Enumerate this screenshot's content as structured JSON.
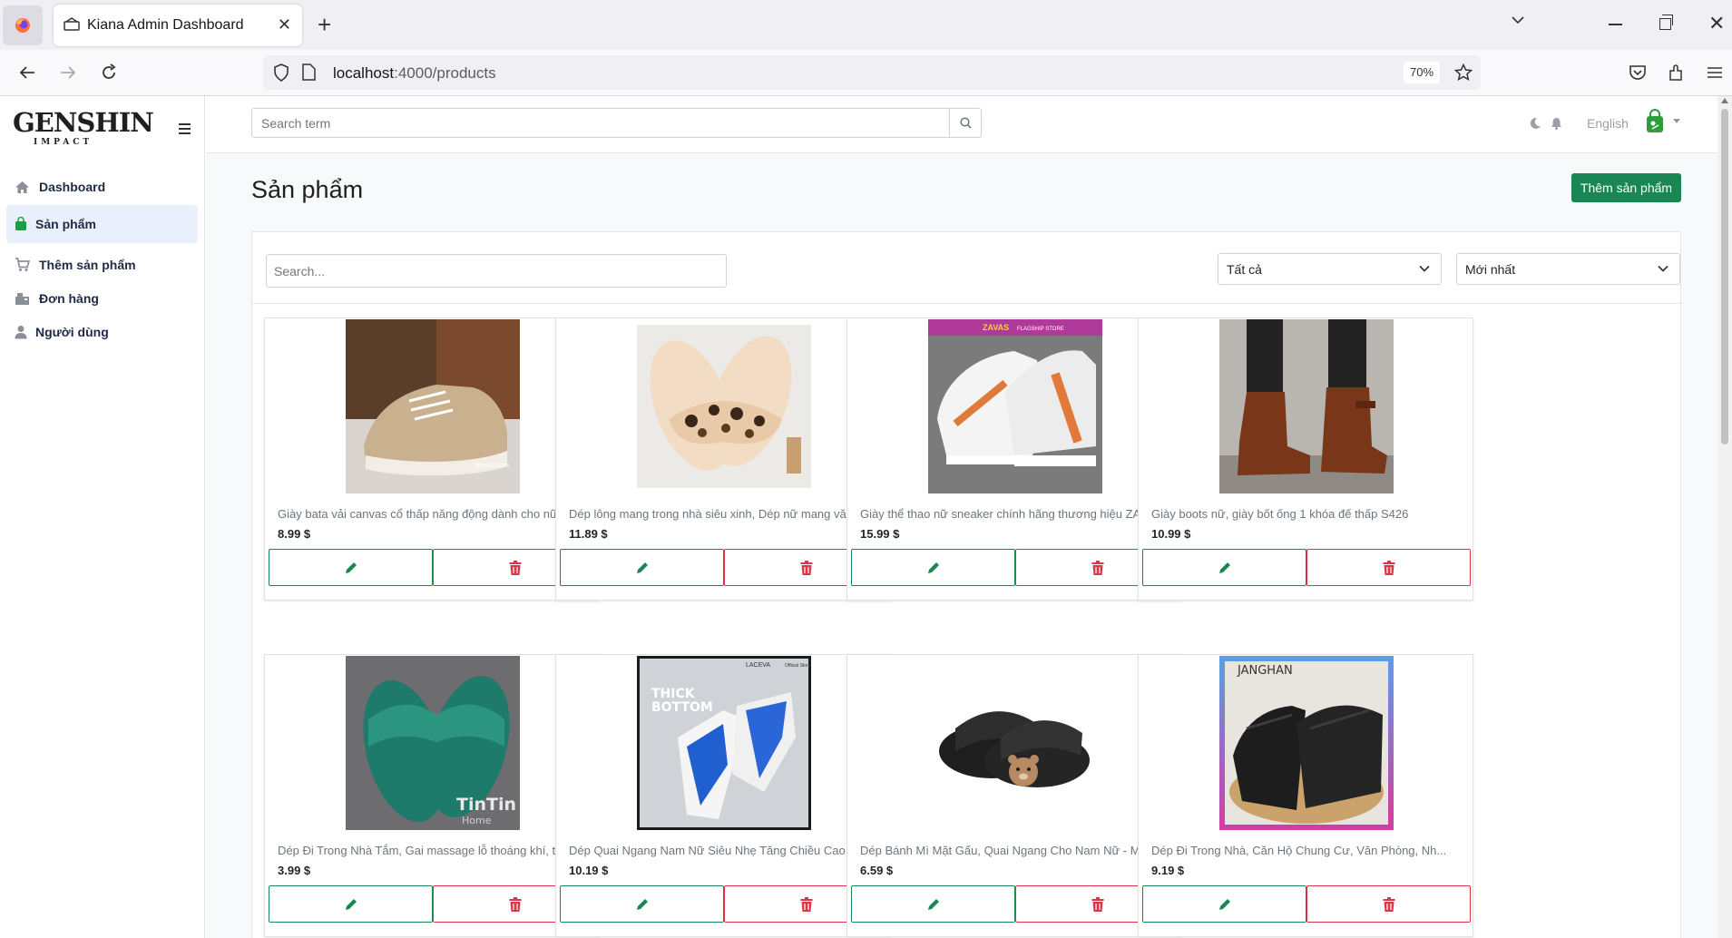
{
  "browser": {
    "tab_title": "Kiana Admin Dashboard",
    "url_host": "localhost",
    "url_rest": ":4000/products",
    "zoom": "70%"
  },
  "sidebar": {
    "logo": "GENSHIN",
    "logo_sub": "IMPACT",
    "items": [
      {
        "label": "Dashboard",
        "icon": "home-icon"
      },
      {
        "label": "Sản phẩm",
        "icon": "shopping-bag-icon"
      },
      {
        "label": "Thêm sản phẩm",
        "icon": "cart-plus-icon"
      },
      {
        "label": "Đơn hàng",
        "icon": "orders-icon"
      },
      {
        "label": "Người dùng",
        "icon": "user-icon"
      }
    ]
  },
  "topbar": {
    "search_placeholder": "Search term",
    "language": "English"
  },
  "main": {
    "title": "Sản phẩm",
    "add_button": "Thêm sản phẩm",
    "filter_placeholder": "Search...",
    "category_select": "Tất cả",
    "sort_select": "Mới nhất"
  },
  "products": [
    {
      "name": "Giày bata vải canvas cổ thấp năng động dành cho nữ",
      "price": "8.99 $",
      "image": "beige-canvas-sneaker"
    },
    {
      "name": "Dép lông mang trong nhà siêu xinh, Dép nữ mang vă...",
      "price": "11.89 $",
      "image": "leopard-fur-slipper"
    },
    {
      "name": "Giày thể thao nữ sneaker chính hãng thương hiệu ZA...",
      "price": "15.99 $",
      "image": "white-orange-sneaker"
    },
    {
      "name": "Giày boots nữ, giày bốt ống 1 khóa đế thấp S426",
      "price": "10.99 $",
      "image": "brown-ankle-boot"
    },
    {
      "name": "Dép Đi Trong Nhà Tắm, Gai massage lỗ thoáng khí, th...",
      "price": "3.99 $",
      "image": "green-massage-slipper"
    },
    {
      "name": "Dép Quai Ngang Nam Nữ Siêu Nhẹ Tăng Chiều Cao C...",
      "price": "10.19 $",
      "image": "white-blue-slide"
    },
    {
      "name": "Dép Bánh Mì Mặt Gấu, Quai Ngang Cho Nam Nữ - M...",
      "price": "6.59 $",
      "image": "black-bear-slide"
    },
    {
      "name": "Dép Đi Trong Nhà, Căn Hộ Chung Cư, Văn Phòng, Nh...",
      "price": "9.19 $",
      "image": "black-house-slide"
    }
  ],
  "image_texts": {
    "p1_watermark": "Mantis.store",
    "p3_brand": "ZAVAS",
    "p3_brand_sub": "FLAGSHIP STORE",
    "p5_brand": "TinTin",
    "p5_brand_sub": "Home",
    "p6_brand": "LACEVA",
    "p6_brand_sub": "Official Store",
    "p6_headline_1": "THICK",
    "p6_headline_2": "BOTTOM",
    "p8_brand": "JANGHAN"
  },
  "colors": {
    "primary_green": "#198754",
    "danger_red": "#dc3545",
    "active_bg": "#eaf0fb"
  }
}
